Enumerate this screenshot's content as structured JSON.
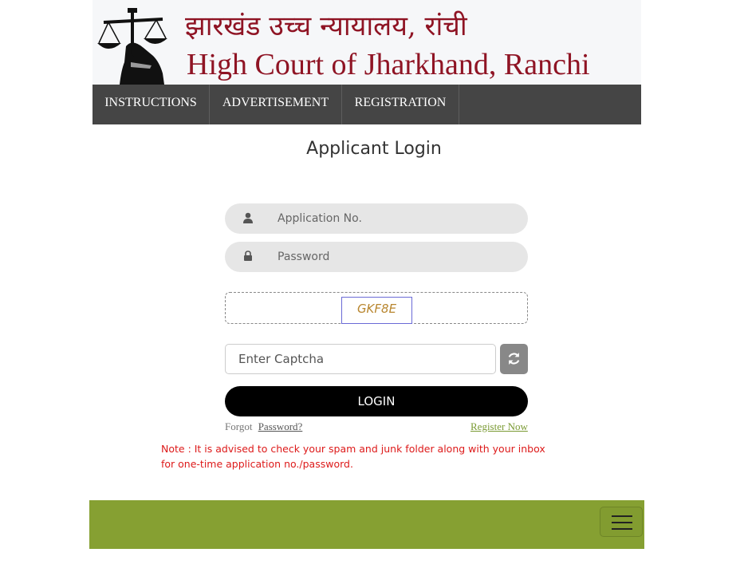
{
  "header": {
    "title_hindi": "झारखंड उच्च न्यायालय, रांची",
    "title_en": "High Court of Jharkhand, Ranchi",
    "logo_icon": "scales-of-justice-icon"
  },
  "nav": {
    "items": [
      {
        "label": "INSTRUCTIONS"
      },
      {
        "label": "ADVERTISEMENT"
      },
      {
        "label": "REGISTRATION"
      }
    ]
  },
  "login": {
    "title": "Applicant Login",
    "application_placeholder": "Application No.",
    "password_placeholder": "Password",
    "captcha_text": "GKF8E",
    "captcha_placeholder": "Enter Captcha",
    "login_label": "LOGIN",
    "forgot_text": "Forgot",
    "forgot_link": "Password?",
    "register_link": "Register Now",
    "note": "Note : It is advised to check your spam and junk folder along with your inbox for one-time application no./password."
  },
  "colors": {
    "brand": "#8f1424",
    "nav_bg": "#454545",
    "footer_bg": "#86a032",
    "note": "#dd1a1a"
  }
}
